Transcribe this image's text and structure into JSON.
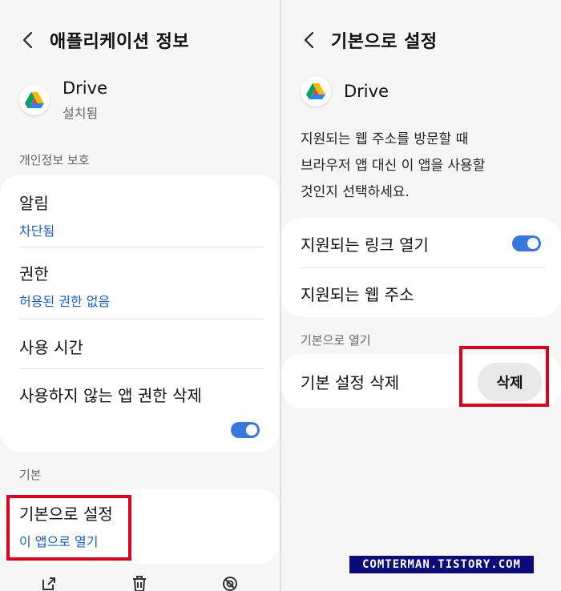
{
  "left": {
    "header": {
      "title": "애플리케이션 정보"
    },
    "app": {
      "name": "Drive",
      "status": "설치됨"
    },
    "privacy_section": "개인정보 보호",
    "items": [
      {
        "title": "알림",
        "sub": "차단됨"
      },
      {
        "title": "권한",
        "sub": "허용된 권한 없음"
      },
      {
        "title": "사용 시간"
      },
      {
        "title": "사용하지 않는 앱 권한 삭제",
        "toggle": true
      }
    ],
    "default_section": "기본",
    "default_item": {
      "title": "기본으로 설정",
      "sub": "이 앱으로 열기"
    },
    "bottom_icons": [
      "open-icon",
      "trash-icon",
      "block-icon"
    ]
  },
  "right": {
    "header": {
      "title": "기본으로 설정"
    },
    "app": {
      "name": "Drive"
    },
    "description_lines": [
      "지원되는 웹 주소를 방문할 때",
      "브라우저 앱 대신 이 앱을 사용할",
      "것인지 선택하세요."
    ],
    "items": [
      {
        "title": "지원되는 링크 열기",
        "toggle": true
      },
      {
        "title": "지원되는 웹 주소"
      }
    ],
    "open_section": "기본으로 열기",
    "clear_item": {
      "title": "기본 설정 삭제",
      "button": "삭제"
    }
  },
  "watermark": "COMTERMAN.TISTORY.COM",
  "colors": {
    "accent": "#3a78e0",
    "link": "#1a5fc9",
    "highlight": "#e0001b"
  }
}
